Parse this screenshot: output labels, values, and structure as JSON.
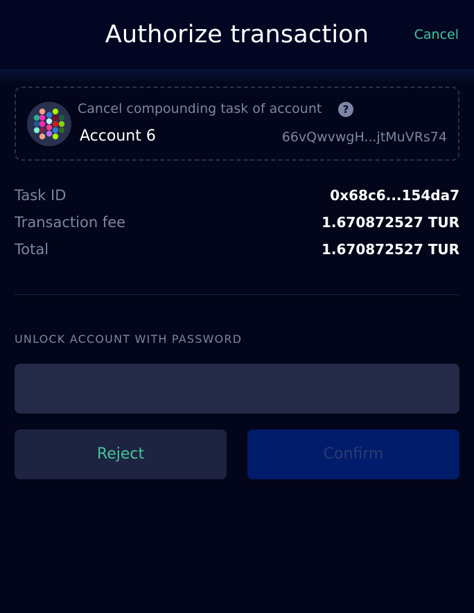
{
  "header": {
    "title": "Authorize transaction",
    "cancel_label": "Cancel"
  },
  "account_card": {
    "description": "Cancel compounding task of account",
    "help_icon": "?",
    "account_name": "Account 6",
    "address": "66vQwvwgH...jtMuVRs74"
  },
  "details": [
    {
      "label": "Task ID",
      "value": "0x68c6...154da7"
    },
    {
      "label": "Transaction fee",
      "value": "1.670872527 TUR"
    },
    {
      "label": "Total",
      "value": "1.670872527 TUR"
    }
  ],
  "password": {
    "label": "UNLOCK ACCOUNT WITH PASSWORD",
    "value": "",
    "placeholder": ""
  },
  "actions": {
    "reject_label": "Reject",
    "confirm_label": "Confirm"
  },
  "colors": {
    "background": "#03051a",
    "accent": "#42c59a",
    "muted_text": "#7e84a3",
    "input_bg": "#252a48",
    "confirm_bg": "#001c6b"
  }
}
